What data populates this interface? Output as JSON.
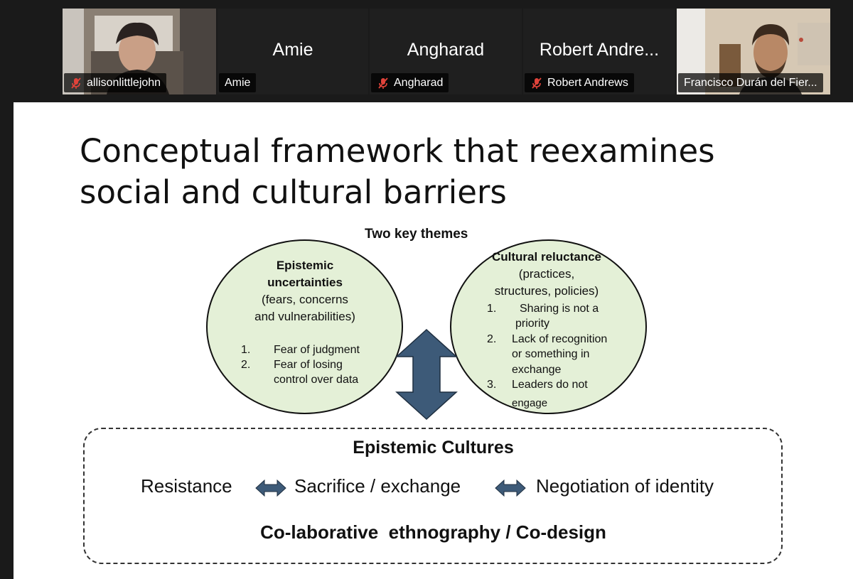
{
  "participants": [
    {
      "name": "allisonlittlejohn",
      "muted": true,
      "video": true
    },
    {
      "name": "Amie",
      "display": "Amie",
      "muted": false,
      "video": false
    },
    {
      "name": "Angharad",
      "display": "Angharad",
      "muted": true,
      "video": false
    },
    {
      "name": "Robert Andrews",
      "display": "Robert Andre...",
      "muted": true,
      "video": false
    },
    {
      "name": "Francisco Durán del Fier...",
      "muted": false,
      "video": true,
      "active_speaker": true
    }
  ],
  "slide": {
    "title_line1": "Conceptual framework that reexamines",
    "title_line2": "social and cultural barriers",
    "themes_label": "Two key themes",
    "left_circle": {
      "heading1": "Epistemic",
      "heading2": "uncertainties",
      "sub1": "(fears, concerns",
      "sub2": "and vulnerabilities)",
      "items": [
        "Fear of judgment",
        "Fear of losing",
        "control over data"
      ],
      "numbers": [
        "1.",
        "2."
      ]
    },
    "right_circle": {
      "heading": "Cultural reluctance",
      "sub1": "(practices,",
      "sub2": "structures, policies)",
      "numbers": [
        "1.",
        "2.",
        "3."
      ],
      "item1a": "Sharing is not a",
      "item1b": "priority",
      "item2a": "Lack of recognition",
      "item2b": "or something in",
      "item2c": "exchange",
      "item3a": "Leaders do not",
      "item3b": "engage"
    },
    "cultures_title": "Epistemic Cultures",
    "flow": [
      "Resistance",
      "Sacrifice / exchange",
      "Negotiation of identity"
    ],
    "bottom_label": "Co-laborative  ethnography / Co-design"
  },
  "colors": {
    "circle_fill": "#e4f0d7",
    "arrow_fill": "#3d5a78",
    "active_border": "#7bd16a",
    "mute_red": "#e0433a"
  }
}
